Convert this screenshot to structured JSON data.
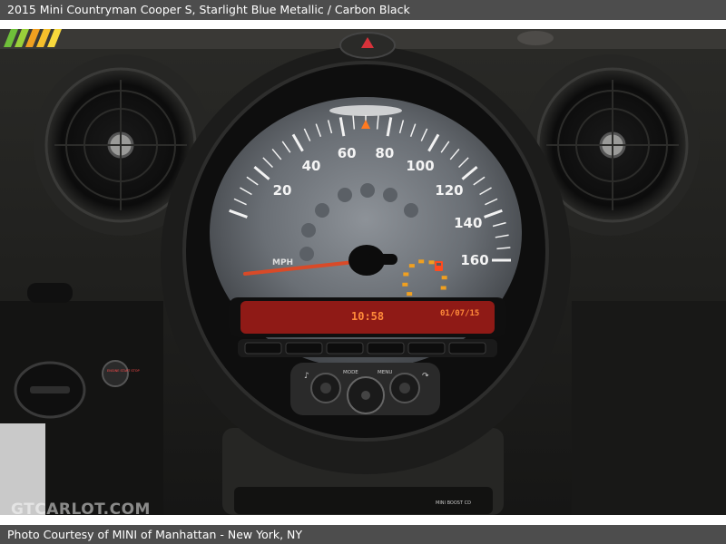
{
  "header": {
    "caption": "2015 Mini Countryman Cooper S,  Starlight Blue Metallic / Carbon Black"
  },
  "gauge": {
    "speed_labels": [
      "20",
      "40",
      "60",
      "80",
      "100",
      "120",
      "140",
      "160"
    ],
    "unit": "MPH",
    "clock": "10:58",
    "date": "01/07/15",
    "mode_label": "MODE",
    "menu_label": "MENU",
    "bottom_label": "MINI BOOST CD"
  },
  "button_labels": {
    "left": "ENGINE START STOP"
  },
  "watermark": {
    "text": "GTCARLOT.COM"
  },
  "footer": {
    "credit": "Photo Courtesy of MINI of Manhattan - New York, NY"
  },
  "colors": {
    "bar": "#4d4d4d",
    "display_red": "#8f1a16",
    "display_text": "#ff8a3a",
    "needle": "#d94a28",
    "fuel": "#f0a020"
  },
  "icons": [
    "air-vent-icon",
    "fuel-pump-icon",
    "hazard-triangle-icon",
    "skip-back-icon",
    "skip-forward-icon"
  ]
}
